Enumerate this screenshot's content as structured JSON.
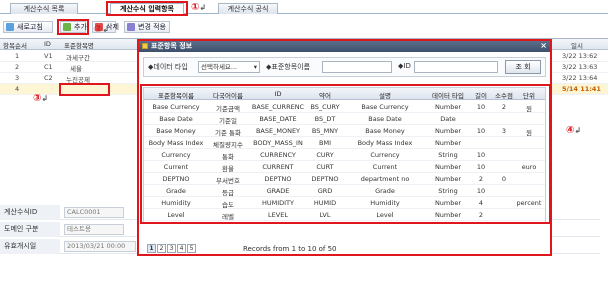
{
  "tabs": [
    {
      "label": "계산수식 목록"
    },
    {
      "label": "계산수식 입력항목"
    },
    {
      "label": "계산수식 공식"
    }
  ],
  "toolbar": {
    "refresh_label": "새로고침",
    "add_label": "추가",
    "delete_label": "삭제",
    "apply_label": "변경 적용"
  },
  "grid": {
    "headers": [
      "항목순서",
      "ID",
      "표준항목명",
      "",
      "일시"
    ],
    "rows": [
      {
        "order": "1",
        "id": "V1",
        "name": "과세구간",
        "time": "3/22 13:62"
      },
      {
        "order": "2",
        "id": "C1",
        "name": "세율",
        "time": "3/22 13:63"
      },
      {
        "order": "3",
        "id": "C2",
        "name": "누진공제",
        "time": "3/22 13:64"
      },
      {
        "order": "4",
        "id": "",
        "name": "",
        "time": "5/14 11:41"
      }
    ]
  },
  "form": {
    "rows": [
      {
        "label": "계산수식ID",
        "value": "CALC0001"
      },
      {
        "label": "도메인 구분",
        "value": "테스트용"
      },
      {
        "label": "유효개시일",
        "value": "2013/03/21 00:00"
      }
    ]
  },
  "annotations": [
    "①",
    "②",
    "③",
    "④"
  ],
  "dialog": {
    "title": "표준항목 정보",
    "close": "×",
    "search": {
      "type_label": "◆데이터 타입",
      "type_value": "선택하세요...",
      "name_label": "◆표준항목이름",
      "id_label": "◆ID",
      "button": "조 회"
    },
    "columns": [
      "표준항목이름",
      "다국어이름",
      "ID",
      "약어",
      "설명",
      "데이터 타입",
      "길이",
      "소수점",
      "단위"
    ],
    "rows": [
      [
        "Base Currency",
        "기준금액",
        "BASE_CURRENC",
        "BS_CURY",
        "Base Currency",
        "Number",
        "10",
        "2",
        "원"
      ],
      [
        "Base Date",
        "기준일",
        "BASE_DATE",
        "BS_DT",
        "Base Date",
        "Date",
        "",
        "",
        ""
      ],
      [
        "Base Money",
        "기준 통화",
        "BASE_MONEY",
        "BS_MNY",
        "Base Money",
        "Number",
        "10",
        "3",
        "원"
      ],
      [
        "Body Mass Index",
        "체질량지수",
        "BODY_MASS_IN",
        "BMI",
        "Body Mass Index",
        "Number",
        "",
        "",
        ""
      ],
      [
        "Currency",
        "통화",
        "CURRENCY",
        "CURY",
        "Currency",
        "String",
        "10",
        "",
        ""
      ],
      [
        "Current",
        "환율",
        "CURRENT",
        "CURT",
        "Current",
        "Number",
        "10",
        "",
        "euro"
      ],
      [
        "DEPTNO",
        "부서번호",
        "DEPTNO",
        "DEPTNO",
        "department no",
        "Number",
        "2",
        "0",
        ""
      ],
      [
        "Grade",
        "등급",
        "GRADE",
        "GRD",
        "Grade",
        "String",
        "10",
        "",
        ""
      ],
      [
        "Humidity",
        "습도",
        "HUMIDITY",
        "HUMID",
        "Humidity",
        "Number",
        "4",
        "",
        "percent"
      ],
      [
        "Level",
        "레벨",
        "LEVEL",
        "LVL",
        "Level",
        "Number",
        "2",
        "",
        ""
      ]
    ],
    "pager": [
      "1",
      "2",
      "3",
      "4",
      "5"
    ],
    "records": "Records from 1 to 10 of 50"
  }
}
